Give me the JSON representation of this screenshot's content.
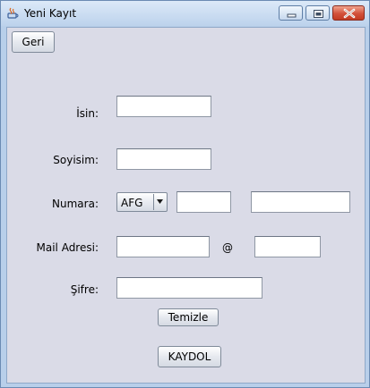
{
  "window": {
    "title": "Yeni Kayıt"
  },
  "toolbar": {
    "back_label": "Geri"
  },
  "form": {
    "name_label": "İsin:",
    "surname_label": "Soyisim:",
    "phone_label": "Numara:",
    "phone_country_selected": "AFG",
    "mail_label": "Mail Adresi:",
    "at_symbol": "@",
    "password_label": "Şifre:",
    "clear_label": "Temizle",
    "register_label": "KAYDOL"
  },
  "colors": {
    "client_background": "#dadbe7",
    "close_button": "#c23a22"
  }
}
